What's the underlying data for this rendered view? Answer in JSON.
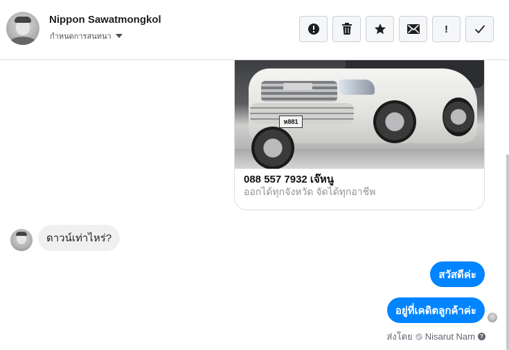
{
  "header": {
    "contact_name": "Nippon Sawatmongkol",
    "assign_label": "กำหนดการสนทนา",
    "tools": [
      {
        "icon": "alert-circle-icon",
        "glyph": "!"
      },
      {
        "icon": "trash-icon"
      },
      {
        "icon": "star-icon"
      },
      {
        "icon": "envelope-icon"
      },
      {
        "icon": "exclamation-icon",
        "glyph": "!"
      },
      {
        "icon": "checkmark-icon"
      }
    ]
  },
  "chat": {
    "card": {
      "plate_text": "ห881",
      "title": "088 557 7932 เจ๊หนู",
      "subtitle": "ออกได้ทุกจังหวัด จัดได้ทุกอาชีพ"
    },
    "incoming": {
      "text": "ดาวน์เท่าไหร่?"
    },
    "outgoing": [
      {
        "text": "สวัสดีค่ะ"
      },
      {
        "text": "อยู่ที่เคดิตลูกค้าค่ะ"
      }
    ],
    "sent_by": {
      "prefix": "ส่งโดย",
      "name": "Nisarut Nam",
      "help_glyph": "?"
    }
  },
  "colors": {
    "accent": "#0084ff",
    "incoming_bubble": "#f1f0f0",
    "border": "#dddfe2"
  }
}
